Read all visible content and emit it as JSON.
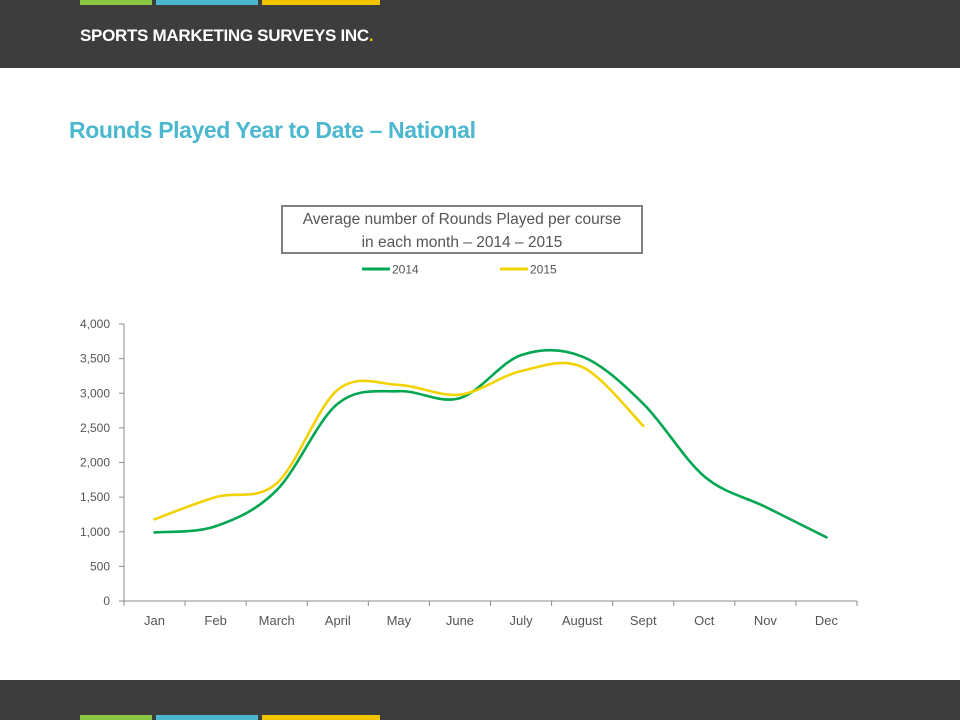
{
  "header": {
    "brand": "SPORTS MARKETING SURVEYS INC",
    "brand_dot": "."
  },
  "slide": {
    "title": "Rounds Played Year to Date – National"
  },
  "colors": {
    "bar": "#3d3d3d",
    "green_stripe": "#8dc63f",
    "blue_stripe": "#4bb8cf",
    "yellow_stripe": "#f2c500",
    "title": "#4bb8cf"
  },
  "chart_data": {
    "type": "line",
    "title": "Average number of Rounds Played per course in each month – 2014 – 2015",
    "title_lines": [
      "Average number of Rounds Played per course",
      "in each month – 2014 – 2015"
    ],
    "categories": [
      "Jan",
      "Feb",
      "March",
      "April",
      "May",
      "June",
      "July",
      "August",
      "Sept",
      "Oct",
      "Nov",
      "Dec"
    ],
    "ylim": [
      0,
      4000
    ],
    "yticks": [
      0,
      500,
      1000,
      1500,
      2000,
      2500,
      3000,
      3500,
      4000
    ],
    "ytick_labels": [
      "0",
      "500",
      "1,000",
      "1,500",
      "2,000",
      "2,500",
      "3,000",
      "3,500",
      "4,000"
    ],
    "grid": false,
    "legend_position": "top",
    "smooth": true,
    "series": [
      {
        "name": "2014",
        "color": "#00a650",
        "values": [
          990,
          1080,
          1600,
          2850,
          3030,
          2930,
          3550,
          3530,
          2850,
          1800,
          1360,
          920
        ]
      },
      {
        "name": "2015",
        "color": "#f2d200",
        "values": [
          1180,
          1500,
          1700,
          3050,
          3120,
          2980,
          3320,
          3380,
          2530
        ]
      }
    ]
  }
}
